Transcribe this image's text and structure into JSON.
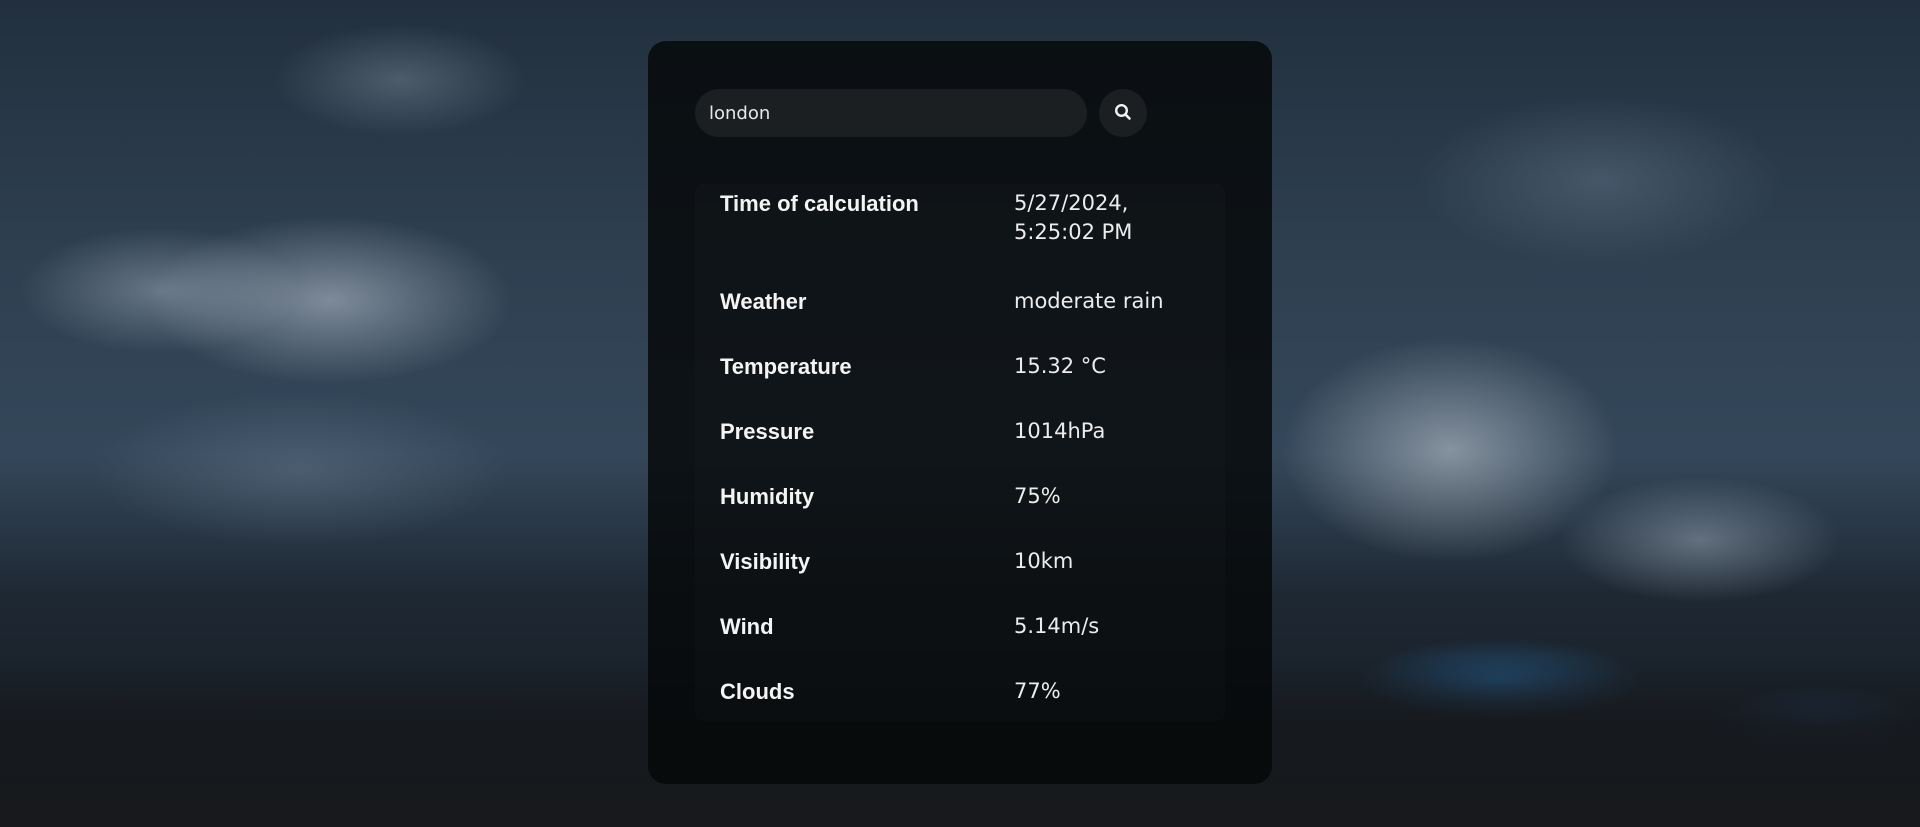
{
  "search": {
    "value": "london"
  },
  "rows": [
    {
      "label": "Time of calculation",
      "value": "5/27/2024, 5:25:02 PM"
    },
    {
      "label": "Weather",
      "value": "moderate rain"
    },
    {
      "label": "Temperature",
      "value": "15.32 °C"
    },
    {
      "label": "Pressure",
      "value": "1014hPa"
    },
    {
      "label": "Humidity",
      "value": "75%"
    },
    {
      "label": "Visibility",
      "value": "10km"
    },
    {
      "label": "Wind",
      "value": "5.14m/s"
    },
    {
      "label": "Clouds",
      "value": "77%"
    }
  ],
  "icons": {
    "search_button": "search-icon"
  }
}
